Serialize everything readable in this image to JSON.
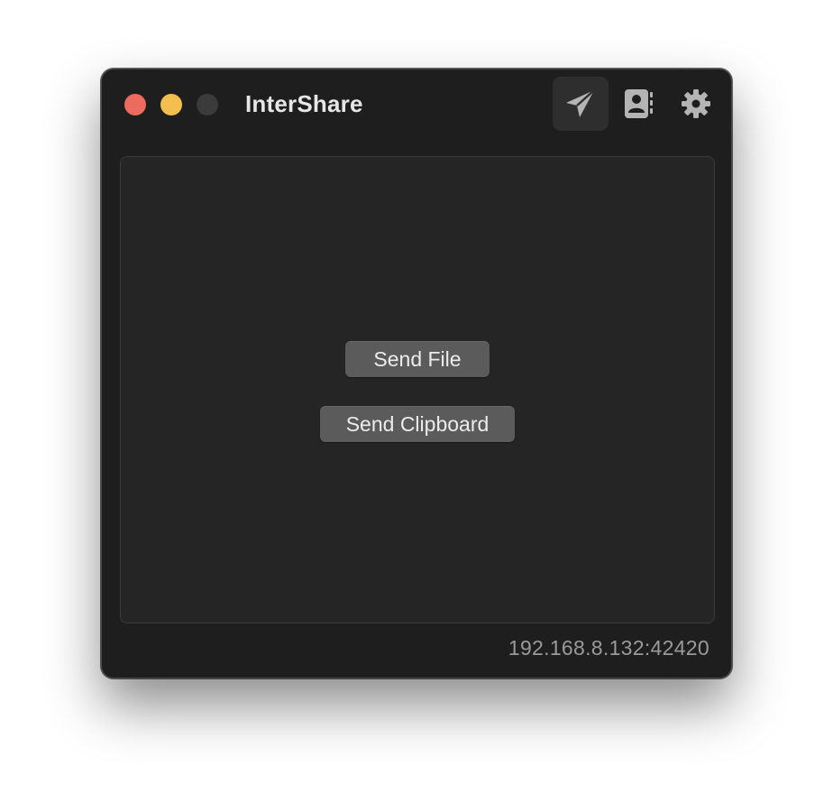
{
  "window": {
    "title": "InterShare"
  },
  "toolbar": {
    "items": [
      {
        "name": "send",
        "icon": "paper-plane-icon",
        "active": true
      },
      {
        "name": "contacts",
        "icon": "contact-book-icon",
        "active": false
      },
      {
        "name": "settings",
        "icon": "gear-icon",
        "active": false
      }
    ]
  },
  "main": {
    "send_file_label": "Send File",
    "send_clipboard_label": "Send Clipboard"
  },
  "footer": {
    "address": "192.168.8.132:42420"
  },
  "colors": {
    "close": "#ed6a5e",
    "minimize": "#f5bf4f",
    "zoom_inactive": "#3b3b3b",
    "window_bg": "#1e1e1e",
    "content_bg": "#252525",
    "button_bg": "#5b5b5b",
    "icon": "#b4b4b4"
  }
}
